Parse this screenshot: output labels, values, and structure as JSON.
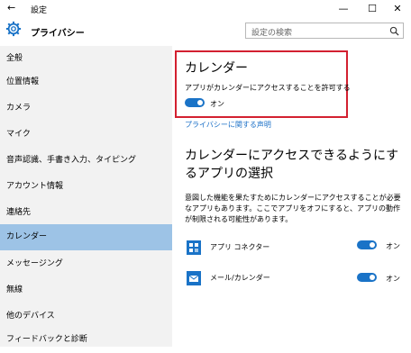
{
  "window": {
    "title": "設定",
    "back_glyph": "←",
    "minimize_glyph": "—",
    "maximize_glyph": "☐",
    "close_glyph": "✕"
  },
  "header": {
    "title": "プライバシー",
    "search_placeholder": "設定の検索"
  },
  "sidebar": {
    "items": [
      {
        "label": "全般"
      },
      {
        "label": "位置情報"
      },
      {
        "label": "カメラ"
      },
      {
        "label": "マイク"
      },
      {
        "label": "音声認識、手書き入力、タイピング"
      },
      {
        "label": "アカウント情報"
      },
      {
        "label": "連絡先"
      },
      {
        "label": "カレンダー",
        "active": true
      },
      {
        "label": "メッセージング"
      },
      {
        "label": "無線"
      },
      {
        "label": "他のデバイス"
      },
      {
        "label": "フィードバックと診断"
      }
    ]
  },
  "main": {
    "section_title": "カレンダー",
    "allow_text": "アプリがカレンダーにアクセスすることを許可する",
    "main_toggle_label": "オン",
    "privacy_link": "プライバシーに関する声明",
    "apps_heading": "カレンダーにアクセスできるようにするアプリの選択",
    "apps_description": "意図した機能を果たすためにカレンダーにアクセスすることが必要なアプリもあります。ここでアプリをオフにすると、アプリの動作が制限される可能性があります。",
    "apps": [
      {
        "name": "アプリ コネクター",
        "toggle": "オン",
        "icon": "app-connector-icon"
      },
      {
        "name": "メール/カレンダー",
        "toggle": "オン",
        "icon": "mail-calendar-icon"
      }
    ]
  },
  "colors": {
    "accent": "#1a73c7",
    "sidebar_bg": "#f2f2f2",
    "sidebar_active": "#9dc3e6",
    "highlight_box": "#d32030",
    "link": "#1a6fc7"
  }
}
